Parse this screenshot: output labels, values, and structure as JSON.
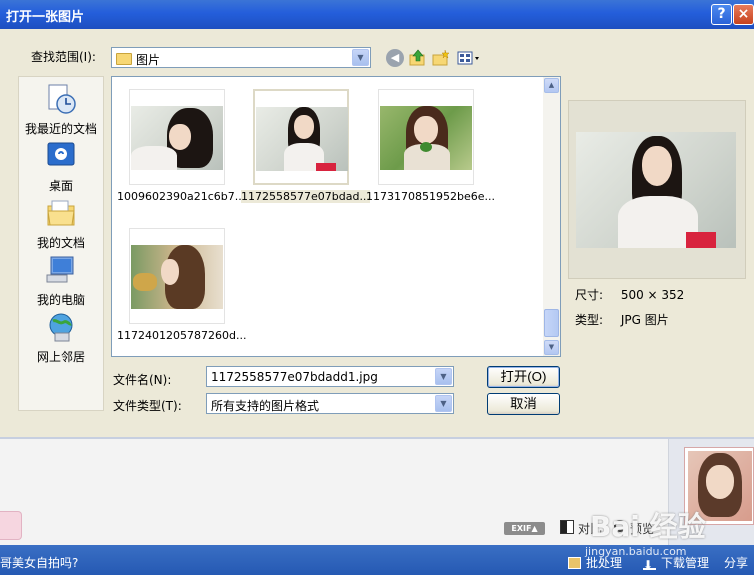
{
  "dialog": {
    "title": "打开一张图片",
    "help_label": "?",
    "close_label": "×",
    "look_in_label": "查找范围(I):",
    "look_in_value": "图片"
  },
  "places": [
    {
      "label": "我最近的文档",
      "icon": "recent-documents-icon"
    },
    {
      "label": "桌面",
      "icon": "desktop-icon"
    },
    {
      "label": "我的文档",
      "icon": "my-documents-icon"
    },
    {
      "label": "我的电脑",
      "icon": "my-computer-icon"
    },
    {
      "label": "网上邻居",
      "icon": "network-places-icon"
    }
  ],
  "files": [
    {
      "name": "1009602390a21c6b7..."
    },
    {
      "name": "1172558577e07bdad..."
    },
    {
      "name": "1173170851952be6e..."
    },
    {
      "name": "1172401205787260d..."
    }
  ],
  "preview": {
    "size_label": "尺寸:",
    "size_value": "500 × 352",
    "type_label": "类型:",
    "type_value": "JPG 图片"
  },
  "form": {
    "filename_label": "文件名(N):",
    "filename_value": "1172558577e07bdadd1.jpg",
    "filetype_label": "文件类型(T):",
    "filetype_value": "所有支持的图片格式",
    "open_label": "打开(O)",
    "cancel_label": "取消"
  },
  "toolbar": {
    "exif_label": "EXIF▲",
    "compare_label": "对比",
    "zoom_label": "预览"
  },
  "statusbar": {
    "question": "哥美女自拍吗?",
    "batch_label": "批处理",
    "download_label": "下载管理",
    "share_label": "分享"
  },
  "watermark": {
    "main": "Bai 经验",
    "url": "jingyan.baidu.com"
  },
  "colors": {
    "titlebar": "#245edb",
    "dialog_bg": "#ece9d8",
    "statusbar": "#2559b3"
  }
}
